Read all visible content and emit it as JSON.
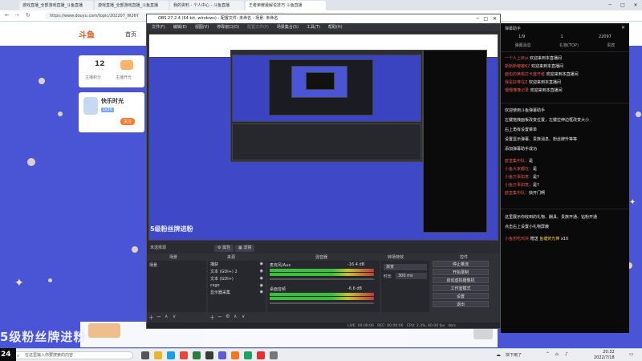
{
  "browser": {
    "tabs": [
      {
        "label": "游戏直播_全部游戏直播_斗鱼直播"
      },
      {
        "label": "游戏直播_全部游戏直播_斗鱼直播"
      },
      {
        "label": "我的资料 - 个人中心 - 斗鱼直播"
      },
      {
        "label": "王者荣耀最解说技巧 斗鱼直播"
      }
    ],
    "url": "https://www.douyu.com/topic/202207_W26Y"
  },
  "site": {
    "logo": "斗鱼",
    "nav_home": "首页",
    "card1_count": "12",
    "card1_label_a": "主播积分",
    "card1_label_b": "主播开光",
    "card2_title": "快乐时光",
    "card2_level": "LV26",
    "card2_action": "关注",
    "fan_banner": "5级粉丝牌进粉",
    "preview_banner": "5级粉丝牌进粉"
  },
  "rpanel": {
    "title": "弹幕助手",
    "stat_a": "1/9",
    "stat_b": "1",
    "stat_c": "22097",
    "tabs": [
      "弹幕消息",
      "礼物(TOP)",
      "贵宾"
    ],
    "welcome": [
      {
        "user": "一个人上床yi",
        "msg": "欢迎来到本直播间"
      },
      {
        "user": "斯斯斯嘟嘟62",
        "msg": "欢迎来到本直播间"
      },
      {
        "user": "面包的黄桃打卡盛开者",
        "msg": "欢迎来到本直播间"
      },
      {
        "user": "我是好棒在Z",
        "msg": "欢迎来到本直播间"
      },
      {
        "user": "懵懵懂懂记录",
        "msg": "欢迎来到本直播间"
      }
    ],
    "notice_lines": [
      "欢迎使用斗鱼弹幕助手",
      "左键拖拽面板改变位置，左键拉伸边框改变大小",
      "右上角有设置菜单",
      "设置显示弹幕、贵族消息、粉丝牌升等等",
      "添加弹幕助手成功"
    ],
    "chat": [
      {
        "user": "欧皇集中队：",
        "msg": "是"
      },
      {
        "user": "小鱼大家都在：",
        "msg": "是"
      },
      {
        "user": "小鱼万事如意：",
        "msg": "是?"
      },
      {
        "user": "小鱼万事如意：",
        "msg": "是?"
      },
      {
        "user": "欧皇集中队：",
        "msg": "快开门啊"
      }
    ],
    "gift_notice_a": "这里展示你收到的礼物、酬具、贵族开通、钻粉开通",
    "gift_notice_b": "点击右上设置小礼物屏蔽",
    "gift_line": {
      "user": "小鱼想吃鸡块",
      "action": "赠送",
      "gift": "鱼塘荧光棒",
      "count": "x10"
    }
  },
  "obs": {
    "title": "OBS 27.2.4 (64-bit, windows) - 配置文件: 未命名 - 场景: 未命名",
    "menu": [
      "文件(F)",
      "编辑(E)",
      "视图(V)",
      "停靠窗口(D)",
      "配置文件(P)",
      "场景集合(S)",
      "工具(T)",
      "帮助(H)"
    ],
    "no_source": "未选择源",
    "props_btn": "属性",
    "filter_btn": "滤镜",
    "scenes_title": "场景",
    "sources_title": "来源",
    "mixer_title": "混音器",
    "transitions_title": "转场特效",
    "controls_title": "控件",
    "scene_item": "场景",
    "sources": [
      "捕获",
      "文本 (GDI+) 2",
      "文本 (GDI+)",
      "csgo",
      "显示器采集"
    ],
    "mixer_tracks": [
      {
        "name": "麦克风/Aux",
        "db": "-16.4 dB"
      },
      {
        "name": "桌面音频",
        "db": "-6.6 dB"
      }
    ],
    "transition_value": "渐变",
    "duration_label": "时长",
    "duration_value": "300 ms",
    "controls": [
      "停止推流",
      "开始录制",
      "启动虚拟摄像机",
      "工作室模式",
      "设置",
      "退出"
    ],
    "status": {
      "live": "LIVE: 00:00:00",
      "rec": "REC: 00:00:00",
      "cpu": "CPU: 2.3%, 60.00 fps",
      "kbps": "kb/s"
    }
  },
  "taskbar": {
    "search_placeholder": "在这里输入你要搜索的内容",
    "weather": "快下雨了",
    "time": "20:32",
    "date": "2022/7/18",
    "edge_text": "24"
  },
  "colors": {
    "page_bg": "#4a55d6",
    "accent_orange": "#e05a1e",
    "chat_user": "#e6574e"
  }
}
